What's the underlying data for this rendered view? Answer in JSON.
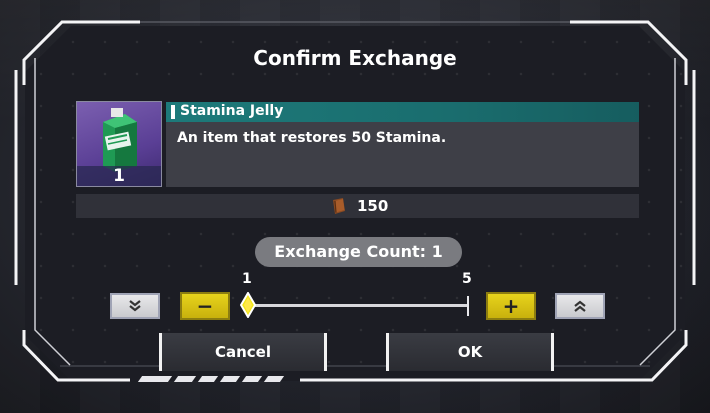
{
  "dialog": {
    "title": "Confirm Exchange"
  },
  "item": {
    "name": "Stamina Jelly",
    "description": "An item that restores 50 Stamina.",
    "owned_count": "1",
    "icon": "stamina-jelly-icon"
  },
  "cost": {
    "icon": "currency-book-icon",
    "value": "150"
  },
  "exchange": {
    "count_label": "Exchange Count: 1",
    "min_label": "1",
    "max_label": "5",
    "slider_fraction": 0
  },
  "buttons": {
    "min_icon": "double-chevron-down-icon",
    "decrement_label": "−",
    "increment_label": "+",
    "max_icon": "double-chevron-up-icon",
    "cancel_label": "Cancel",
    "ok_label": "OK"
  },
  "colors": {
    "accent_teal": "#1d7a7a",
    "step_yellow": "#e7d31c",
    "dialog_bg": "#1c1d24"
  }
}
